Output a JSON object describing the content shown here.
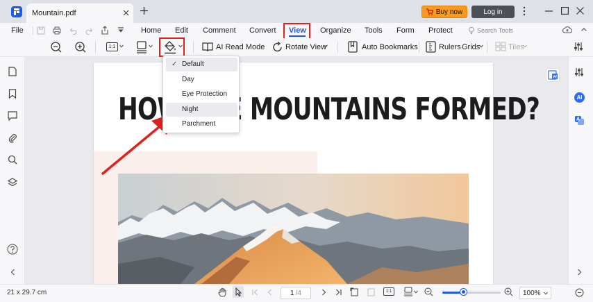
{
  "window": {
    "tab_title": "Mountain.pdf",
    "buy_now_label": "Buy now",
    "login_label": "Log in"
  },
  "menu": {
    "file": "File",
    "items": [
      "Home",
      "Edit",
      "Comment",
      "Convert",
      "View",
      "Organize",
      "Tools",
      "Form",
      "Protect"
    ],
    "search_placeholder": "Search Tools"
  },
  "toolbar": {
    "fit_label": "1:1",
    "ai_read_mode": "AI Read Mode",
    "rotate_view": "Rotate View",
    "auto_bookmarks": "Auto Bookmarks",
    "rulers": "Rulers",
    "grids": "Grids",
    "tiles": "Tiles"
  },
  "theme_menu": {
    "items": [
      "Default",
      "Day",
      "Eye Protection",
      "Night",
      "Parchment"
    ],
    "selected": "Default",
    "hovered": "Night"
  },
  "document": {
    "title": "HOW ARE MOUNTAINS FORMED?"
  },
  "status": {
    "page_size": "21 x 29.7 cm",
    "current_page": "1",
    "total_pages": "/4",
    "zoom": "100%",
    "zoom_fraction": 0.36
  },
  "colors": {
    "accent": "#1f5ae6",
    "annotation_red": "#e0201c",
    "buy_orange": "#f79a1f"
  }
}
